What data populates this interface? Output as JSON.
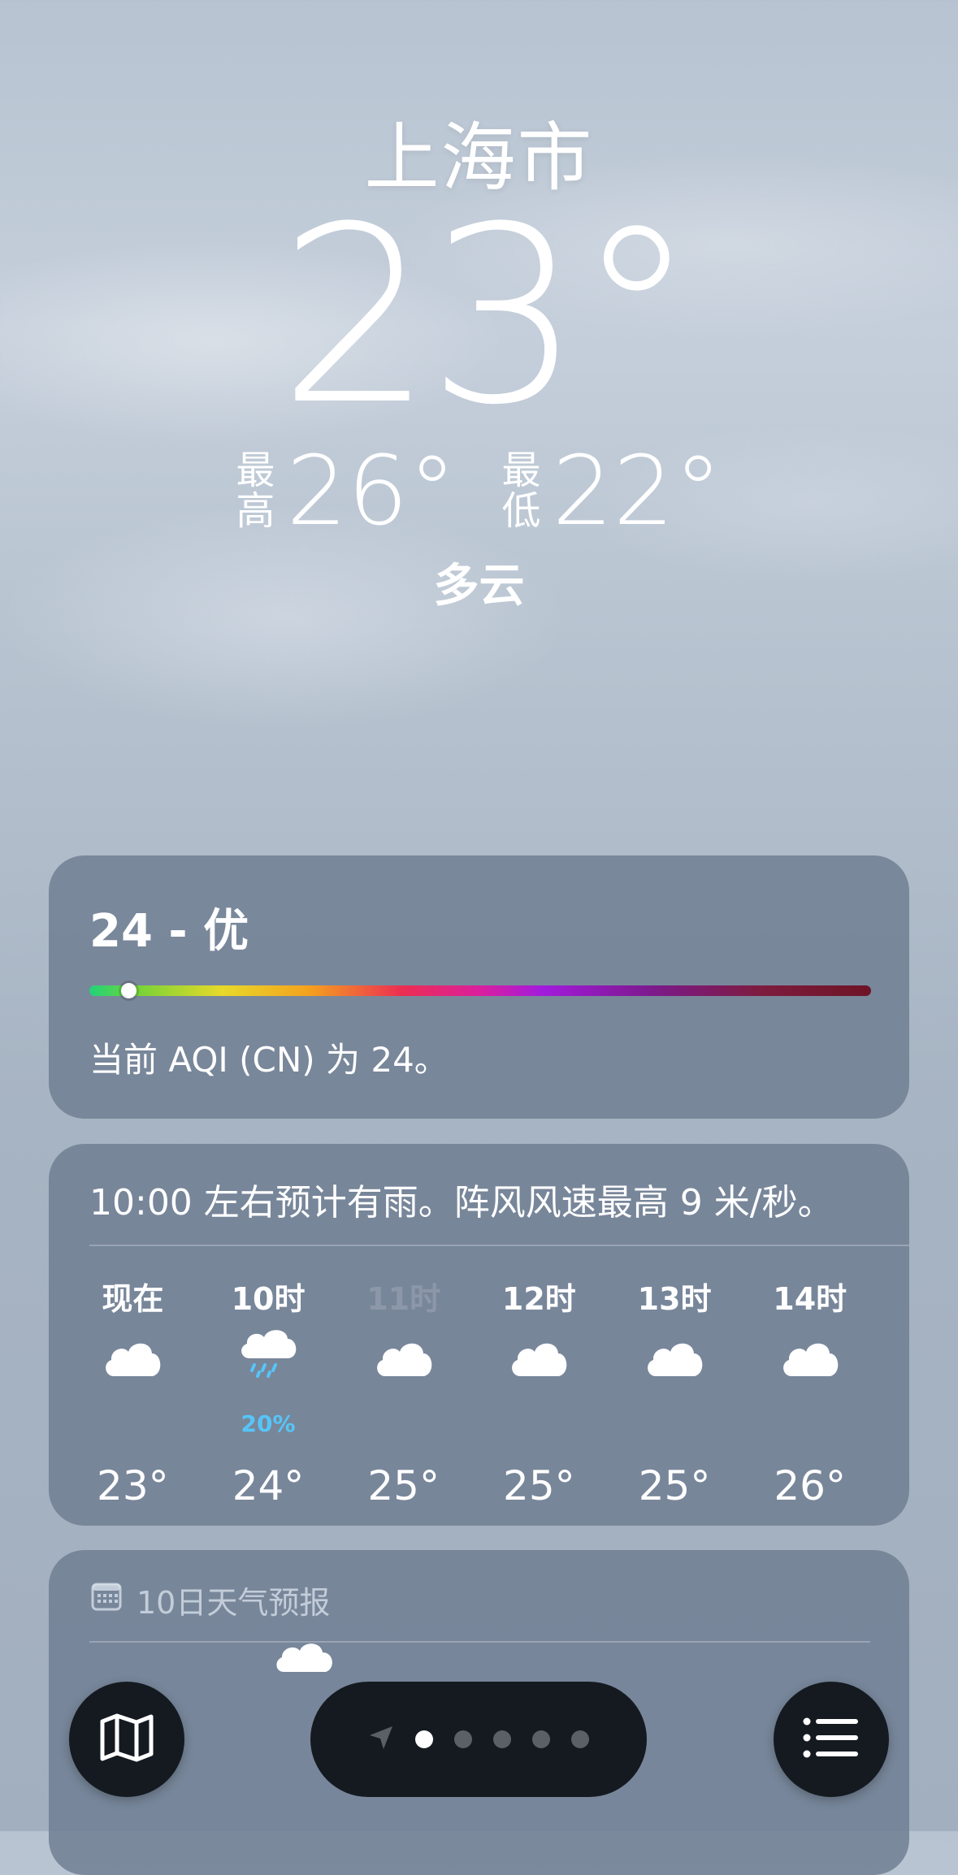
{
  "location": {
    "city": "上海市",
    "temperature": "23°",
    "high_label": "最高",
    "high_value": "26°",
    "low_label": "最低",
    "low_value": "22°",
    "condition": "多云"
  },
  "aqi": {
    "headline": "24 - 优",
    "description": "当前 AQI (CN) 为 24。",
    "value": 24,
    "scale_position_fraction": 0.05
  },
  "hourly": {
    "summary": "10:00 左右预计有雨。阵风风速最高 9 米/秒。",
    "items": [
      {
        "time": "现在",
        "icon": "cloud-icon",
        "precip": "",
        "temp": "23°"
      },
      {
        "time": "10时",
        "icon": "cloud-rain-icon",
        "precip": "20%",
        "temp": "24°"
      },
      {
        "time": "11时",
        "icon": "cloud-icon",
        "precip": "",
        "temp": "25°"
      },
      {
        "time": "12时",
        "icon": "cloud-icon",
        "precip": "",
        "temp": "25°"
      },
      {
        "time": "13时",
        "icon": "cloud-icon",
        "precip": "",
        "temp": "25°"
      },
      {
        "time": "14时",
        "icon": "cloud-icon",
        "precip": "",
        "temp": "26°"
      }
    ]
  },
  "forecast": {
    "header": "10日天气预报",
    "icon": "calendar-icon"
  },
  "toolbar": {
    "map_icon": "map-icon",
    "list_icon": "list-icon",
    "location_icon": "location-arrow-icon",
    "page_count": 5,
    "active_page": 0
  },
  "colors": {
    "precip": "#56c5f8",
    "card_bg": "#6e7d91",
    "toolbar_bg": "#151a20"
  }
}
